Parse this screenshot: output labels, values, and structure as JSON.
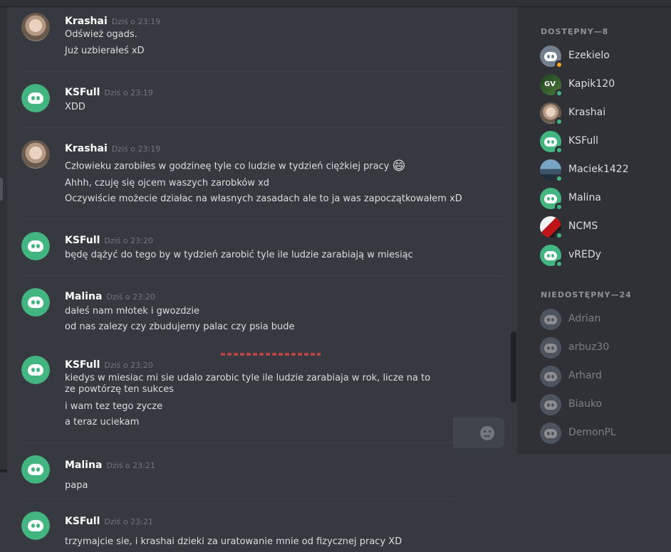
{
  "colors": {
    "online": "#43b581",
    "idle": "#faa61a",
    "green_avatar": "#43b581",
    "grey_avatar": "#747f8d",
    "offline_avatar": "#747f8d"
  },
  "messages": [
    {
      "author": "Krashai",
      "time": "Dziś o 23:19",
      "avatar": "photo",
      "lines": [
        "Odśwież ogads.",
        "Już uzbierałeś xD"
      ]
    },
    {
      "author": "KSFull",
      "time": "Dziś o 23:19",
      "avatar": "discord-green",
      "lines": [
        "XDD"
      ]
    },
    {
      "author": "Krashai",
      "time": "Dziś o 23:19",
      "avatar": "photo",
      "lines": [
        "Człowieku zarobiłes w godzineę tyle co ludzie w tydzień ciężkiej pracy",
        "Ahhh, czuję się ojcem waszych zarobków xd",
        "Oczywiście możecie działac na własnych zasadach ale to ja was zapoczątkowałem xD"
      ],
      "emoji": "😄"
    },
    {
      "author": "KSFull",
      "time": "Dziś o 23:20",
      "avatar": "discord-green",
      "lines": [
        "będę dążyć do tego by w tydzień zarobić tyle ile ludzie zarabiają w miesiąc"
      ]
    },
    {
      "author": "Malina",
      "time": "Dziś o 23:20",
      "avatar": "discord-green",
      "lines": [
        "dałeś nam młotek i gwozdzie",
        "od nas zalezy czy zbudujemy palac czy psia bude"
      ]
    },
    {
      "author": "KSFull",
      "time": "Dziś o 23:20",
      "avatar": "discord-green",
      "lines": [
        "kiedys w miesiac mi sie udalo zarobic tyle ile ludzie zarabiaja w rok, licze na to ze powtórzę ten sukces",
        "i wam tez tego zycze",
        "a teraz uciekam"
      ]
    },
    {
      "author": "Malina",
      "time": "Dziś o 23:21",
      "avatar": "discord-green",
      "lines": [
        "papa"
      ]
    },
    {
      "author": "KSFull",
      "time": "Dziś o 23:21",
      "avatar": "discord-green",
      "lines": [
        "trzymajcie sie, i krashai dzieki za uratowanie mnie od fizycznej pracy XD"
      ]
    }
  ],
  "members": {
    "online_title": "DOSTĘPNY—8",
    "offline_title": "NIEDOSTĘPNY—24",
    "online": [
      {
        "name": "Ezekielo",
        "status": "idle",
        "avatar": "discord-grey"
      },
      {
        "name": "Kapik120",
        "status": "online",
        "avatar": "image-gv"
      },
      {
        "name": "Krashai",
        "status": "online",
        "avatar": "photo"
      },
      {
        "name": "KSFull",
        "status": "online",
        "avatar": "discord-green"
      },
      {
        "name": "Maciek1422",
        "status": "online",
        "avatar": "image-landscape"
      },
      {
        "name": "Malina",
        "status": "online",
        "avatar": "discord-green"
      },
      {
        "name": "NCMS",
        "status": "online",
        "avatar": "image-red"
      },
      {
        "name": "vREDy",
        "status": "online",
        "avatar": "discord-green"
      }
    ],
    "offline": [
      {
        "name": "Adrian",
        "avatar": "discord-grey"
      },
      {
        "name": "arbuz30",
        "avatar": "discord-grey"
      },
      {
        "name": "Arhard",
        "avatar": "discord-grey"
      },
      {
        "name": "Biauko",
        "avatar": "discord-grey"
      },
      {
        "name": "DemonPL",
        "avatar": "discord-grey"
      }
    ]
  }
}
